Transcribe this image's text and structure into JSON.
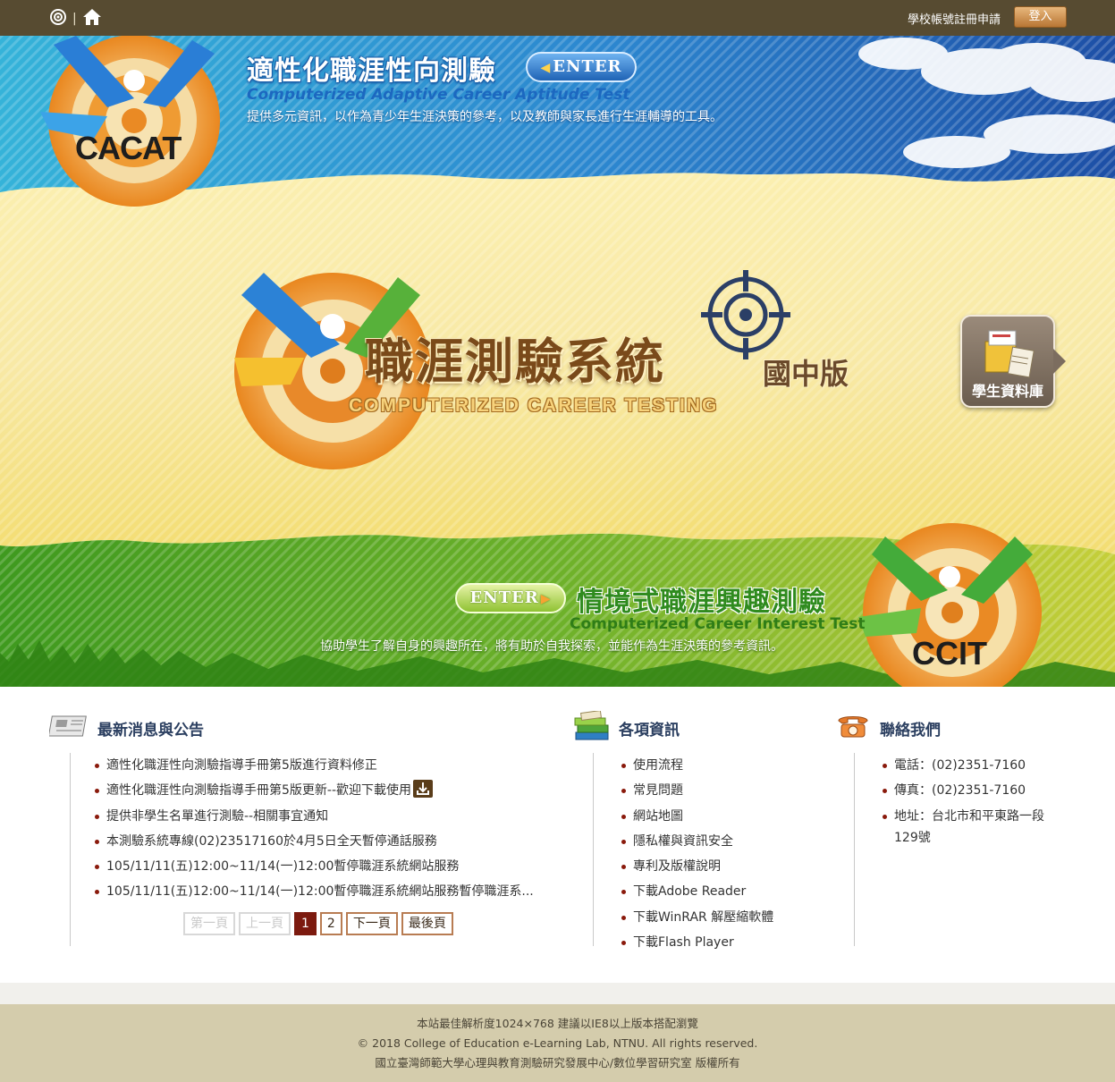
{
  "topbar": {
    "register_label": "學校帳號註冊申請",
    "login_label": "登入",
    "separator": "|"
  },
  "banner": {
    "cacat": {
      "title": "適性化職涯性向測驗",
      "enter_label": "ENTER",
      "english": "Computerized Adaptive Career Aptitude Test",
      "description": "提供多元資訊，以作為青少年生涯決策的參考，以及教師與家長進行生涯輔導的工具。",
      "logo_text": "CACAT"
    },
    "main": {
      "title": "職涯測驗系統",
      "edition": "國中版",
      "english": "COMPUTERIZED CAREER TESTING"
    },
    "student_db_label": "學生資料庫",
    "ccit": {
      "enter_label": "ENTER",
      "title": "情境式職涯興趣測驗",
      "english": "Computerized Career Interest Test",
      "description": "協助學生了解自身的興趣所在，將有助於自我探索，並能作為生涯決策的參考資訊。",
      "logo_text": "CCIT"
    },
    "colors": {
      "sky": "#2f9bd6",
      "yellow": "#f6e08a",
      "green": "#4a9e22",
      "orange": "#e8892a"
    }
  },
  "news": {
    "title": "最新消息與公告",
    "items": [
      "適性化職涯性向測驗指導手冊第5版進行資料修正",
      "適性化職涯性向測驗指導手冊第5版更新--歡迎下載使用",
      "提供非學生名單進行測驗--相關事宜通知",
      "本測驗系統專線(02)23517160於4月5日全天暫停通話服務",
      "105/11/11(五)12:00~11/14(一)12:00暫停職涯系統網站服務",
      "105/11/11(五)12:00~11/14(一)12:00暫停職涯系統網站服務暫停職涯系..."
    ],
    "pager": {
      "first": "第一頁",
      "prev": "上一頁",
      "pages": [
        "1",
        "2"
      ],
      "current": "1",
      "next": "下一頁",
      "last": "最後頁"
    }
  },
  "info": {
    "title": "各項資訊",
    "items": [
      "使用流程",
      "常見問題",
      "網站地圖",
      "隱私權與資訊安全",
      "專利及版權說明",
      "下載Adobe Reader",
      "下載WinRAR 解壓縮軟體",
      "下載Flash Player"
    ]
  },
  "contact": {
    "title": "聯絡我們",
    "phone": "電話：(02)2351-7160",
    "fax": "傳真：(02)2351-7160",
    "address_line1": "地址：台北市和平東路一段",
    "address_line2": "129號"
  },
  "footer": {
    "line1": "本站最佳解析度1024×768 建議以IE8以上版本搭配瀏覽",
    "line2": "© 2018 College of Education e-Learning Lab, NTNU. All rights reserved.",
    "line3": "國立臺灣師範大學心理與教育測驗研究發展中心/數位學習研究室 版權所有"
  }
}
